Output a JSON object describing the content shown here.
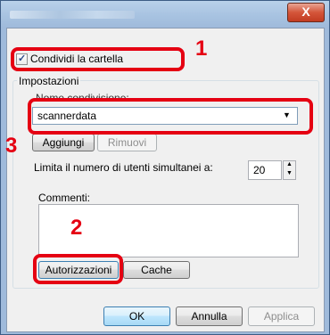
{
  "window": {
    "close_glyph": "X"
  },
  "share": {
    "checkbox_label": "Condividi la cartella",
    "checked": true
  },
  "settings": {
    "group_label": "Impostazioni",
    "share_name_label": "Nome condivisione:",
    "share_name_value": "scannerdata",
    "add_label": "Aggiungi",
    "remove_label": "Rimuovi",
    "limit_label": "Limita il numero di utenti simultanei a:",
    "limit_value": "20",
    "comments_label": "Commenti:",
    "comments_value": "",
    "permissions_label": "Autorizzazioni",
    "cache_label": "Cache"
  },
  "footer": {
    "ok_label": "OK",
    "cancel_label": "Annulla",
    "apply_label": "Applica"
  },
  "callouts": {
    "step1": "1",
    "step2": "2",
    "step3": "3"
  },
  "colors": {
    "callout_red": "#e50012",
    "title_bar": "#a9c4e2"
  },
  "icons": {
    "dropdown": "chevron-down-icon",
    "spin_up": "spin-up-icon",
    "spin_down": "spin-down-icon",
    "close": "close-icon"
  }
}
